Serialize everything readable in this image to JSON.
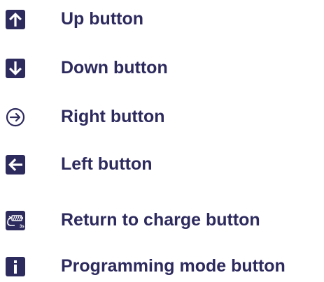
{
  "legend": {
    "items": [
      {
        "icon": "up-arrow-icon",
        "label": "Up button"
      },
      {
        "icon": "down-arrow-icon",
        "label": "Down button"
      },
      {
        "icon": "right-arrow-circle-icon",
        "label": "Right button"
      },
      {
        "icon": "left-arrow-icon",
        "label": "Left button"
      },
      {
        "icon": "return-to-charge-icon",
        "label": "Return to charge button",
        "icon_text": "3s"
      },
      {
        "icon": "info-icon",
        "label": "Programming mode button"
      }
    ]
  },
  "colors": {
    "icon_fill": "#2d2a5e",
    "label_text": "#2d2a5e",
    "background": "#ffffff"
  }
}
